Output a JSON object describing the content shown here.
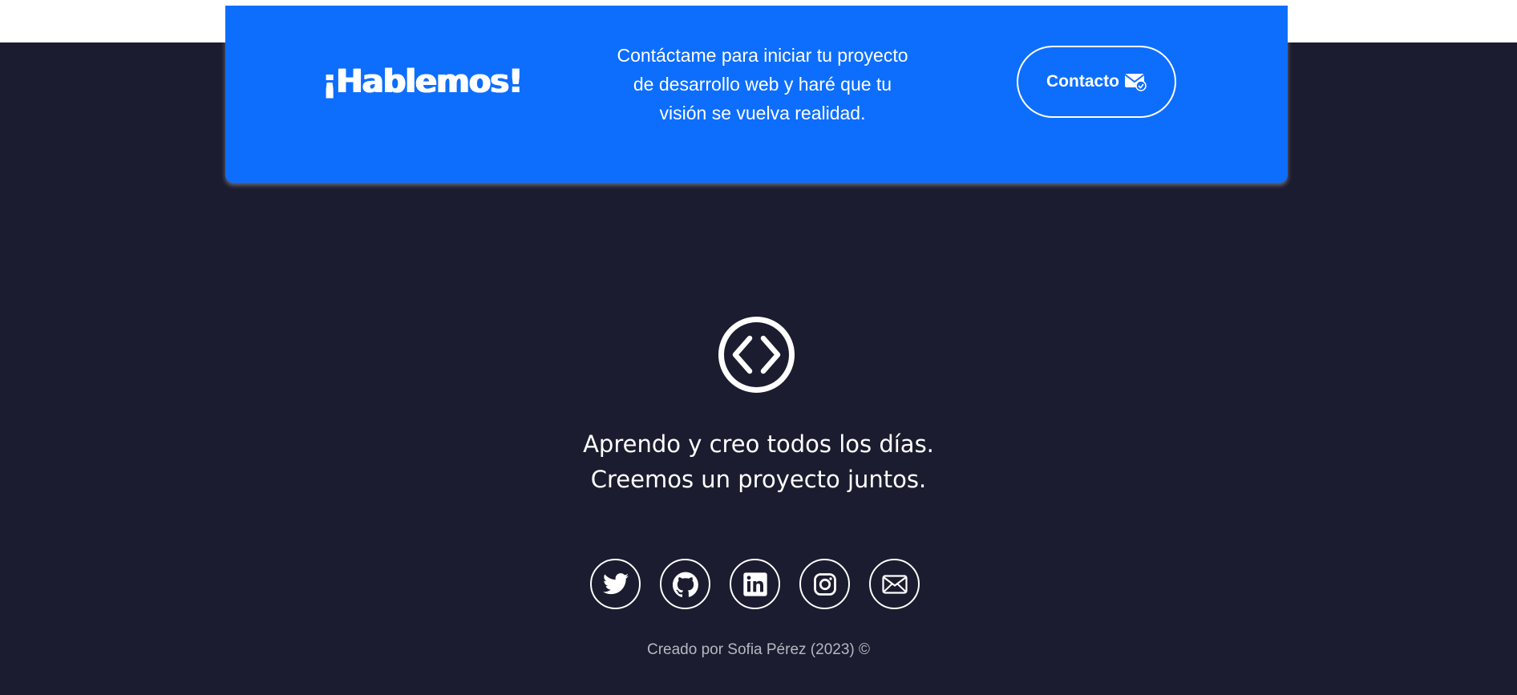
{
  "cta": {
    "title": "¡Hablemos!",
    "text_line1": "Contáctame para iniciar tu proyecto",
    "text_line2": "de desarrollo web y haré que tu",
    "text_line3": "visión se vuelva realidad.",
    "button_label": "Contacto",
    "button_icon": "envelope-check-icon"
  },
  "footer": {
    "logo_icon": "code-circle-icon",
    "tagline_line1": "Aprendo y creo todos los días.",
    "tagline_line2": "Creemos un proyecto juntos.",
    "socials": [
      {
        "icon": "twitter-icon"
      },
      {
        "icon": "github-icon"
      },
      {
        "icon": "linkedin-icon"
      },
      {
        "icon": "instagram-icon"
      },
      {
        "icon": "email-icon"
      }
    ],
    "credit": "Creado por Sofia Pérez (2023) ©"
  },
  "colors": {
    "background": "#1c1c30",
    "accent": "#0d6efd",
    "text": "#ffffff",
    "muted_text": "#b7b7c2"
  }
}
